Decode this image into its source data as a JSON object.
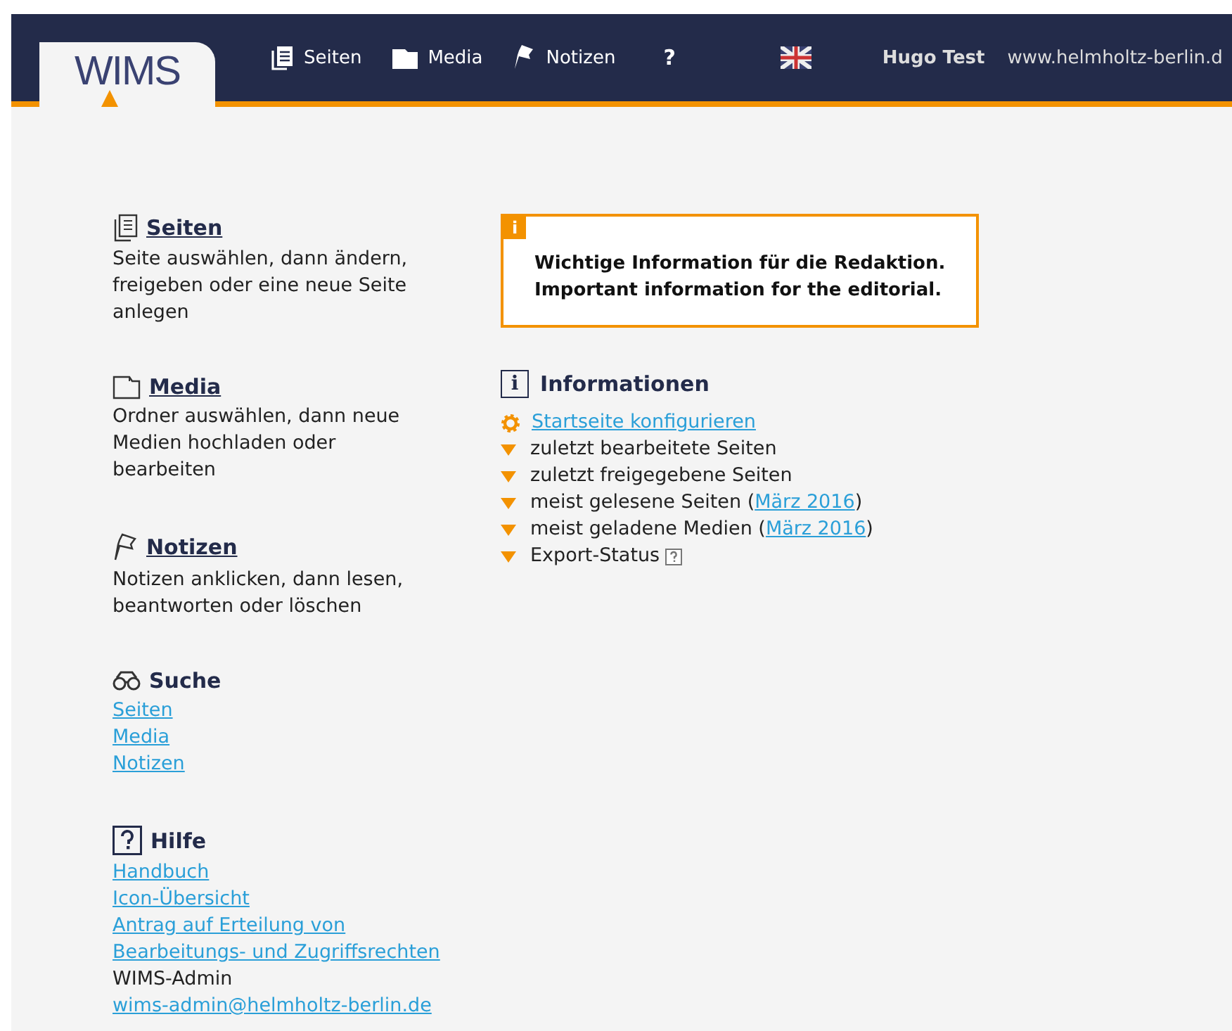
{
  "header": {
    "logo": "WIMS",
    "nav": [
      {
        "kind": "pages",
        "label": "Seiten"
      },
      {
        "kind": "media",
        "label": "Media"
      },
      {
        "kind": "notes",
        "label": "Notizen"
      },
      {
        "kind": "help",
        "label": "?"
      }
    ],
    "user": "Hugo Test",
    "site": "www.helmholtz-berlin.d"
  },
  "sections": [
    {
      "kind": "pages",
      "title": "Seiten",
      "description": "Seite auswählen, dann ändern, freigeben oder eine neue Seite anlegen"
    },
    {
      "kind": "media",
      "title": "Media",
      "description": "Ordner auswählen, dann neue Medien hochladen oder bearbeiten"
    },
    {
      "kind": "notes",
      "title": "Notizen",
      "description": "Notizen anklicken, dann lesen, beantworten oder löschen"
    },
    {
      "kind": "search",
      "title": "Suche",
      "items": [
        {
          "kind": "link",
          "text": "Seiten"
        },
        {
          "kind": "link",
          "text": "Media"
        },
        {
          "kind": "link",
          "text": "Notizen"
        }
      ]
    },
    {
      "kind": "help",
      "title": "Hilfe",
      "items": [
        {
          "kind": "link",
          "text": "Handbuch"
        },
        {
          "kind": "link",
          "text": "Icon-Übersicht"
        },
        {
          "kind": "link",
          "text": "Antrag auf Erteilung von Bearbeitungs- und Zugriffsrechten"
        },
        {
          "kind": "text",
          "text": "WIMS-Admin"
        },
        {
          "kind": "link",
          "text": "wims-admin@helmholtz-berlin.de"
        }
      ]
    }
  ],
  "notice": {
    "badge": "i",
    "lines": [
      "Wichtige Information für die Redaktion.",
      "Important information for the editorial."
    ]
  },
  "info": {
    "badge": "i",
    "title": "Informationen",
    "items": [
      {
        "kind": "gear",
        "link": "Startseite konfigurieren"
      },
      {
        "kind": "arrow",
        "text": "zuletzt bearbeitete Seiten"
      },
      {
        "kind": "arrow",
        "text": "zuletzt freigegebene Seiten"
      },
      {
        "kind": "arrow",
        "text": "meist gelesene Seiten (",
        "link": "März 2016",
        "after": ")"
      },
      {
        "kind": "arrow",
        "text": "meist geladene Medien (",
        "link": "März 2016",
        "after": ")"
      },
      {
        "kind": "arrow",
        "text": "Export-Status",
        "help": true
      }
    ]
  }
}
